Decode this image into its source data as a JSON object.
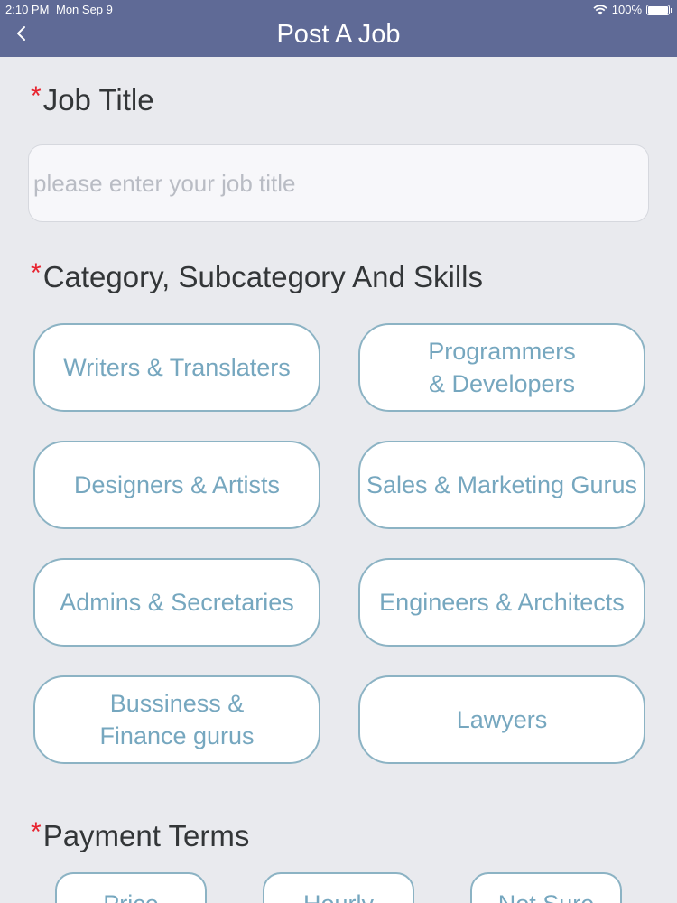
{
  "status_bar": {
    "time": "2:10 PM",
    "date": "Mon Sep 9",
    "battery": "100%",
    "battery_level": 1.0
  },
  "header": {
    "title": "Post A Job"
  },
  "job_title": {
    "required_mark": "*",
    "label": "Job Title",
    "placeholder": "please enter your job title",
    "value": ""
  },
  "category": {
    "required_mark": "*",
    "label": "Category, Subcategory And Skills",
    "items": [
      {
        "label": "Writers & Translaters"
      },
      {
        "label": "Programmers\n& Developers"
      },
      {
        "label": "Designers & Artists"
      },
      {
        "label": "Sales & Marketing Gurus"
      },
      {
        "label": "Admins & Secretaries"
      },
      {
        "label": "Engineers & Architects"
      },
      {
        "label": "Bussiness &\nFinance gurus"
      },
      {
        "label": "Lawyers"
      }
    ]
  },
  "payment": {
    "required_mark": "*",
    "label": "Payment Terms",
    "options": [
      {
        "label": "Price"
      },
      {
        "label": "Hourly"
      },
      {
        "label": "Not Sure"
      }
    ]
  },
  "colors": {
    "header": "#5f6a96",
    "background": "#e9eaee",
    "button_border": "#8cb3c4",
    "button_text": "#76a7bf",
    "required": "#e8232f"
  }
}
